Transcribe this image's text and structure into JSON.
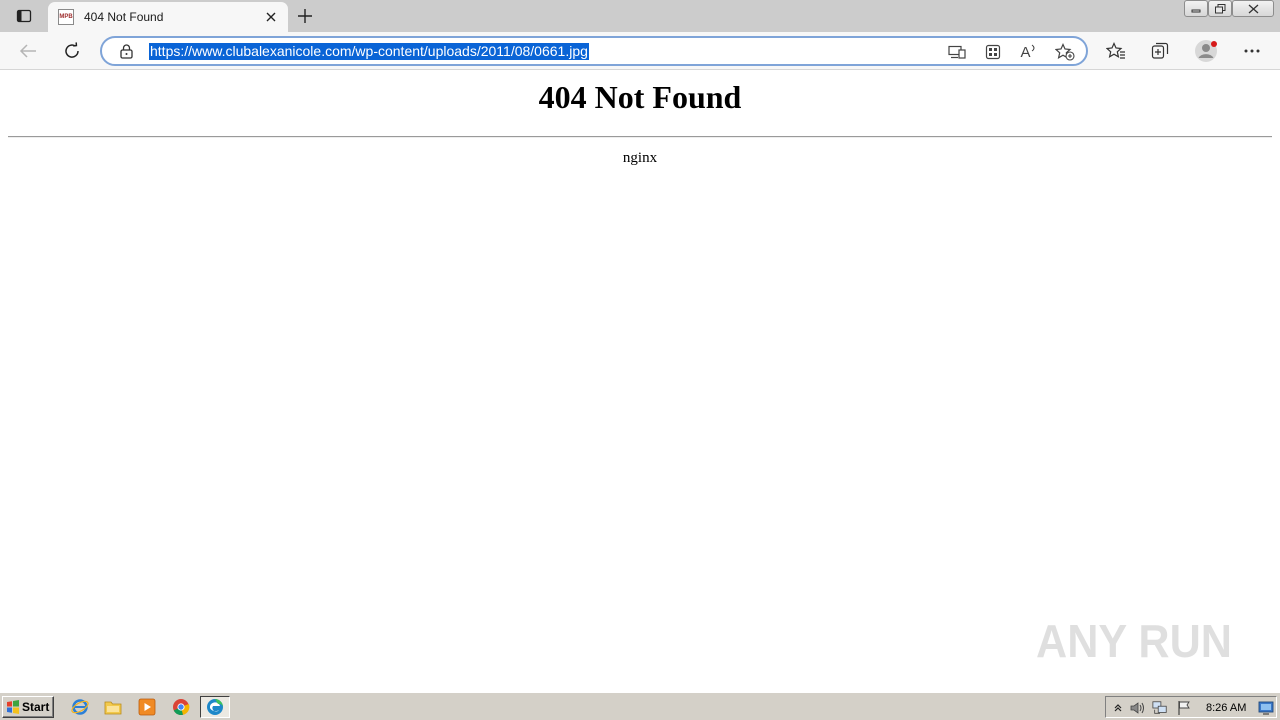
{
  "browser": {
    "tab": {
      "title": "404 Not Found",
      "favicon_text": "MPB",
      "close_icon": "close-icon"
    },
    "new_tab_icon": "plus-icon",
    "address_bar": {
      "url": "https://www.clubalexanicole.com/wp-content/uploads/2011/08/0661.jpg"
    },
    "read_aloud_label": "A",
    "colors": {
      "tabstrip": "#cccccc",
      "toolbar": "#f7f7f7",
      "url_highlight": "#0a64d6",
      "address_border": "#7fa4d8"
    }
  },
  "page": {
    "title": "404 Not Found",
    "server": "nginx"
  },
  "watermark": {
    "text": "ANY RUN"
  },
  "taskbar": {
    "start_label": "Start",
    "apps": [
      "internet-explorer-icon",
      "file-explorer-icon",
      "media-player-icon",
      "chrome-icon",
      "edge-icon"
    ],
    "clock": "8:26 AM"
  }
}
